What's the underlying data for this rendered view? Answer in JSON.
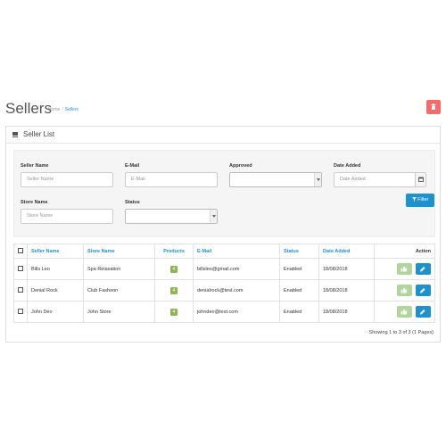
{
  "header": {
    "title": "Sellers",
    "breadcrumb": [
      "Home",
      "Sellers"
    ]
  },
  "panel": {
    "title": "Seller List"
  },
  "filter": {
    "seller_name": {
      "label": "Seller Name",
      "placeholder": "Seller Name",
      "value": ""
    },
    "email": {
      "label": "E-Mail",
      "placeholder": "E-Mail",
      "value": ""
    },
    "approved": {
      "label": "Approved",
      "value": ""
    },
    "date_added": {
      "label": "Date Added",
      "placeholder": "Date Added",
      "value": ""
    },
    "store_name": {
      "label": "Store Name",
      "placeholder": "Store Name",
      "value": ""
    },
    "status": {
      "label": "Status",
      "value": ""
    },
    "filter_button": "Filter"
  },
  "table": {
    "columns": [
      "Seller Name",
      "Store Name",
      "Products",
      "E-Mail",
      "Status",
      "Date Added",
      "Action"
    ],
    "rows": [
      {
        "seller": "Bills Leo",
        "store": "Spa Relaxation",
        "products": "4",
        "email": "billsleo@gmail.com",
        "status": "Enabled",
        "date": "18/08/2018"
      },
      {
        "seller": "Denial Rock",
        "store": "Club Fashoon",
        "products": "4",
        "email": "denialrock@test.com",
        "status": "Enabled",
        "date": "18/08/2018"
      },
      {
        "seller": "John Deo",
        "store": "John Store",
        "products": "4",
        "email": "johndeo@test.com",
        "status": "Enabled",
        "date": "18/08/2018"
      }
    ]
  },
  "pagination_text": "Showing 1 to 3 of 3 (1 Pages)",
  "colors": {
    "accent": "#1e91cf",
    "danger": "#f56b6b",
    "badge": "#8fb550",
    "approve": "#b2d59b"
  },
  "icons": [
    "delete-icon",
    "list-icon",
    "calendar-icon",
    "filter-icon",
    "thumbs-up-icon",
    "pencil-icon"
  ]
}
